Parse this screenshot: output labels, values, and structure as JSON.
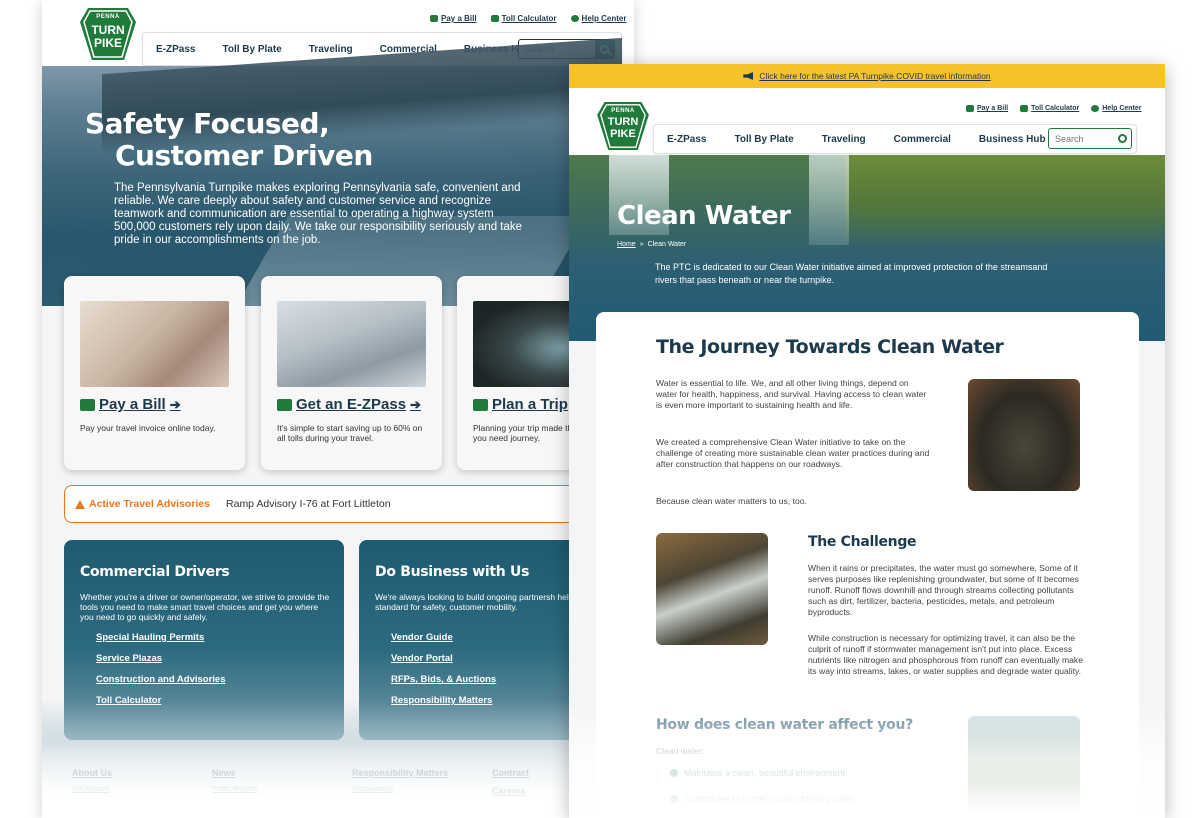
{
  "left": {
    "logo": {
      "top": "PENNA",
      "line1": "TURN",
      "line2": "PIKE"
    },
    "utility": {
      "pay_bill": "Pay a Bill",
      "toll_calc": "Toll Calculator",
      "help": "Help Center"
    },
    "nav": [
      "E-ZPass",
      "Toll By Plate",
      "Traveling",
      "Commercial",
      "Business Hub"
    ],
    "search_placeholder": "Search",
    "hero": {
      "title_line1": "Safety Focused,",
      "title_line2": "Customer Driven",
      "body": "The Pennsylvania Turnpike makes exploring Pennsylvania safe, convenient and reliable.  We care deeply about safety and customer service and recognize teamwork and communication are essential to operating a highway system 500,000 customers rely upon daily. We take our responsibility seriously and take pride in our accomplishments on the job."
    },
    "cards": [
      {
        "title": "Pay a Bill",
        "desc": "Pay your travel invoice online today."
      },
      {
        "title": "Get an E-ZPass",
        "desc": "It's simple to start saving up to 60% on all tolls during your travel."
      },
      {
        "title": "Plan a Trip",
        "desc": "Planning your trip made the resources you need journey."
      }
    ],
    "advisory": {
      "label": "Active Travel Advisories",
      "text": "Ramp Advisory I-76 at Fort Littleton"
    },
    "panels": [
      {
        "title": "Commercial Drivers",
        "desc": "Whether you're a driver or owner/operator, we strive to provide the tools you need to make smart travel choices and get you where you need to go quickly and safely.",
        "links": [
          "Special Hauling Permits",
          "Service Plazas",
          "Construction and Advisories",
          "Toll Calculator"
        ]
      },
      {
        "title": "Do Business with Us",
        "desc": "We're always looking to build ongoing partnersh help us drive the standard for safety, customer mobility.",
        "links": [
          "Vendor Guide",
          "Vendor Portal",
          "RFPs, Bids, & Auctions",
          "Responsibility Matters"
        ]
      }
    ],
    "footer": [
      {
        "head": "About Us",
        "sub": "Our Mission"
      },
      {
        "head": "News",
        "sub": "Traffic Reports"
      },
      {
        "head": "Responsibility Matters",
        "sub": "Sustainability"
      },
      {
        "head": "Contract",
        "sub": "Careers"
      }
    ]
  },
  "right": {
    "covid_link": "Click here for the latest PA Turnpike COVID travel information",
    "logo": {
      "top": "PENNA",
      "line1": "TURN",
      "line2": "PIKE"
    },
    "utility": {
      "pay_bill": "Pay a Bill",
      "toll_calc": "Toll Calculator",
      "help": "Help Center"
    },
    "nav": [
      "E-ZPass",
      "Toll By Plate",
      "Traveling",
      "Commercial",
      "Business Hub"
    ],
    "search_placeholder": "Search",
    "hero": {
      "title": "Clean Water",
      "crumb_home": "Home",
      "crumb_sep": "»",
      "crumb_current": "Clean Water",
      "desc": "The PTC is dedicated to our Clean Water initiative aimed at improved protection of the streamsand rivers that pass beneath or near the turnpike."
    },
    "content": {
      "h1": "The Journey Towards Clean Water",
      "p1": "Water is essential to life. We, and all other living things, depend on water for health, happiness, and survival. Having access to clean water is even more important to sustaining health and life.",
      "p2": "We created a comprehensive Clean Water initiative to take on the challenge of creating more sustainable clean water practices during and after construction that happens on our roadways.",
      "p3": "Because clean water matters to us, too.",
      "challenge_title": "The Challenge",
      "challenge_p1": "When it rains or precipitates, the water must go somewhere. Some of it serves purposes like replenishing groundwater, but some of It becomes runoff. Runoff flows downhill and through streams collecting pollutants such as dirt, fertilizer, bacteria, pesticides, metals, and petroleum byproducts.",
      "challenge_p2": "While construction is necessary for optimizing travel, it can also be the culprit of runoff if stormwater management isn't put into place. Excess nutrients like nitrogen and phosphorous from runoff can eventually make its way into streams, lakes, or water supplies and degrade water quality.",
      "affect_title": "How does clean water affect you?",
      "affect_intro": "Clean water:",
      "checks": [
        "Maintains a clean, beautiful environment",
        "Contributes to higher quality drinking water"
      ]
    }
  },
  "colors": {
    "brand_green": "#1f7a3c",
    "navy": "#1d3a4c",
    "advisory_orange": "#e8781d",
    "covid_yellow": "#f5c22c"
  }
}
